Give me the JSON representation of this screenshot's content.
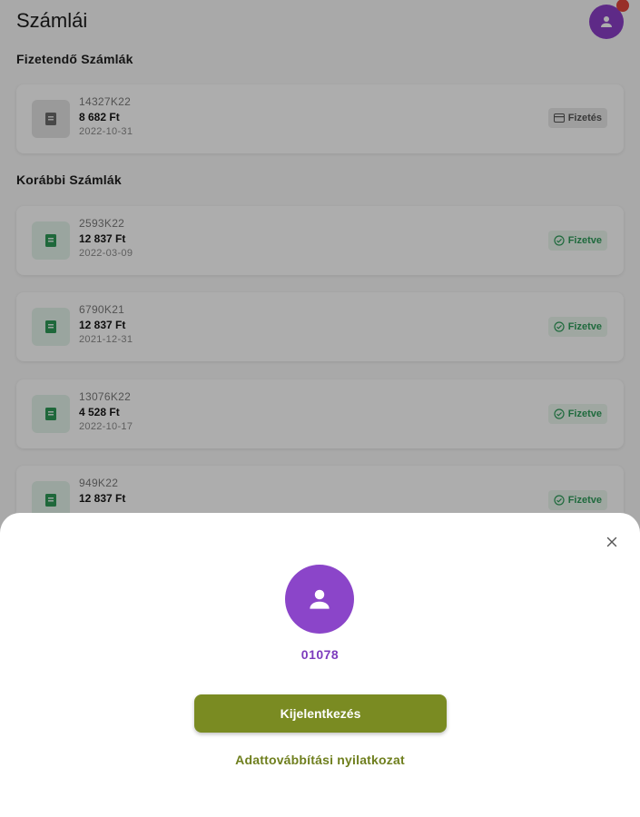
{
  "header": {
    "title": "Számlái",
    "avatar_icon": "person-icon"
  },
  "sections": {
    "payable_title": "Fizetendő Számlák",
    "previous_title": "Korábbi Számlák"
  },
  "payable_invoices": [
    {
      "number": "14327K22",
      "amount": "8 682 Ft",
      "date": "2022-10-31",
      "action_label": "Fizetés",
      "action_icon": "card-icon"
    }
  ],
  "previous_invoices": [
    {
      "number": "2593K22",
      "amount": "12 837 Ft",
      "date": "2022-03-09",
      "status_label": "Fizetve"
    },
    {
      "number": "6790K21",
      "amount": "12 837 Ft",
      "date": "2021-12-31",
      "status_label": "Fizetve"
    },
    {
      "number": "13076K22",
      "amount": "4 528 Ft",
      "date": "2022-10-17",
      "status_label": "Fizetve"
    },
    {
      "number": "949K22",
      "amount": "12 837 Ft",
      "date": "",
      "status_label": "Fizetve"
    }
  ],
  "sheet": {
    "user_id": "01078",
    "logout_label": "Kijelentkezés",
    "privacy_label": "Adattovábbítási nyilatkozat"
  },
  "colors": {
    "accent_purple": "#8b45c9",
    "primary_olive": "#7a8b22",
    "paid_green": "#2e9d5a"
  }
}
